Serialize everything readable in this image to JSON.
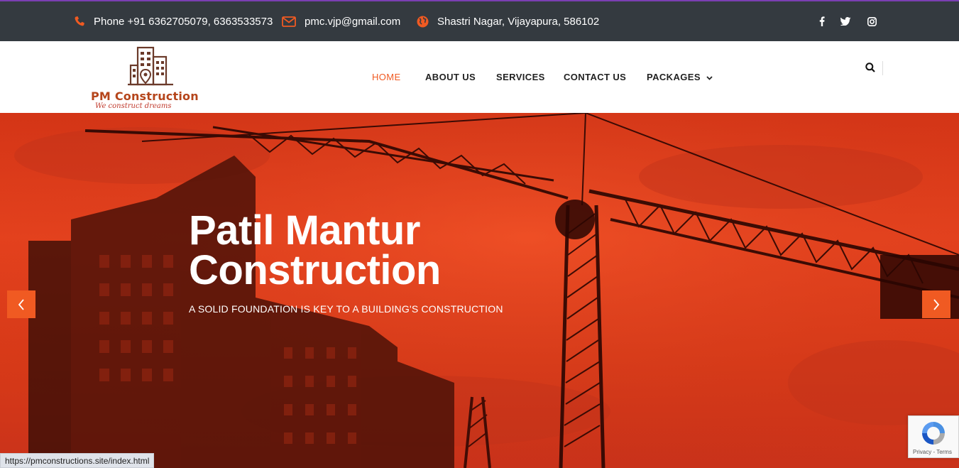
{
  "topbar": {
    "phone": "Phone +91 6362705079, 6363533573",
    "email": "pmc.vjp@gmail.com",
    "address": "Shastri Nagar, Vijayapura, 586102",
    "social": [
      "facebook-icon",
      "twitter-icon",
      "instagram-icon"
    ]
  },
  "header": {
    "logo_title": "PM Construction",
    "logo_tagline": "We construct dreams",
    "nav": {
      "home": "HOME",
      "about": "ABOUT US",
      "services": "SERVICES",
      "contact": "CONTACT US",
      "packages": "PACKAGES"
    }
  },
  "hero": {
    "title_line1": "Patil Mantur",
    "title_line2": "Construction",
    "subtitle": "A SOLID FOUNDATION IS KEY TO A BUILDING'S CONSTRUCTION"
  },
  "status": {
    "url": "https://pmconstructions.site/index.html"
  },
  "recaptcha": {
    "terms": "Privacy - Terms"
  },
  "colors": {
    "accent": "#f05a22",
    "topbar_bg": "#343a40",
    "hero_red": "#e03c1a"
  }
}
